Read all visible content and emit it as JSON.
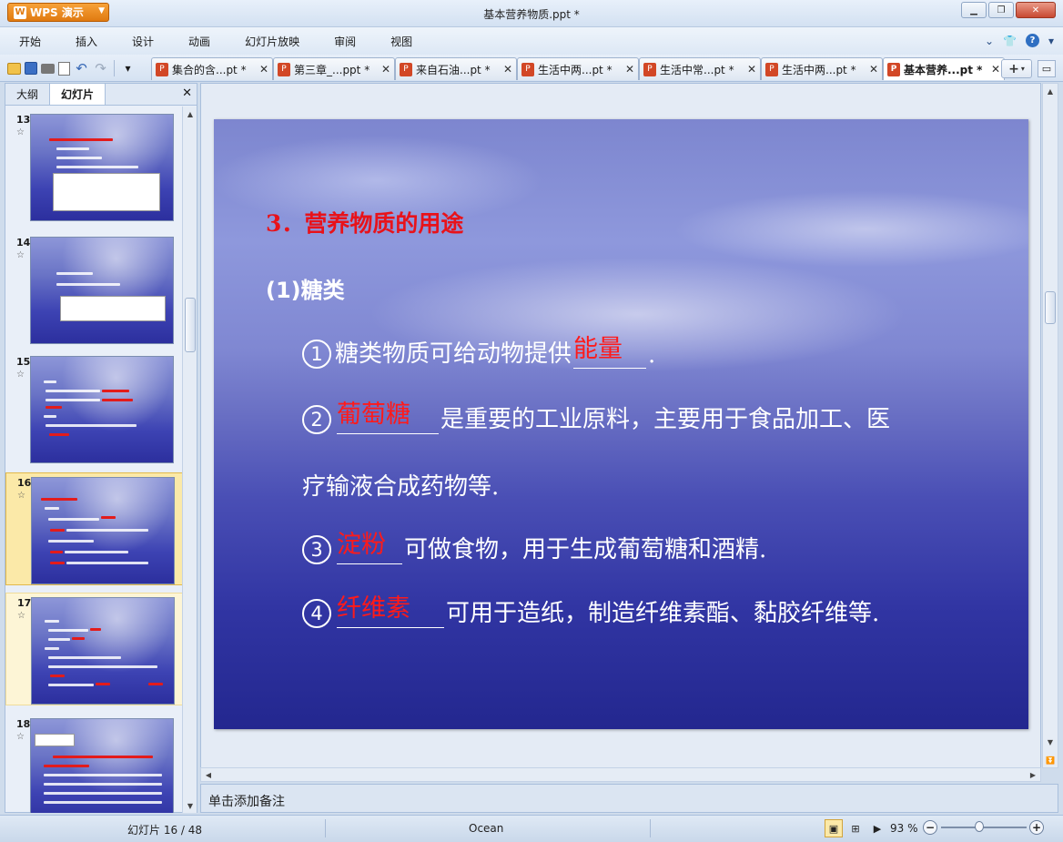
{
  "app": {
    "name": "WPS 演示",
    "window_title": "基本营养物质.ppt *"
  },
  "menu": [
    "开始",
    "插入",
    "设计",
    "动画",
    "幻灯片放映",
    "审阅",
    "视图"
  ],
  "doc_tabs": [
    {
      "label": "集合的含...pt *",
      "active": false
    },
    {
      "label": "第三章_...ppt *",
      "active": false
    },
    {
      "label": "来自石油...pt *",
      "active": false
    },
    {
      "label": "生活中两...pt *",
      "active": false
    },
    {
      "label": "生活中常...pt *",
      "active": false
    },
    {
      "label": "生活中两...pt *",
      "active": false
    },
    {
      "label": "基本营养...pt *",
      "active": true
    }
  ],
  "left_pane": {
    "tabs": [
      "大纲",
      "幻灯片"
    ],
    "active_tab": "幻灯片",
    "thumbnails": [
      {
        "num": "13",
        "star": "☆"
      },
      {
        "num": "14",
        "star": "☆"
      },
      {
        "num": "15",
        "star": "☆"
      },
      {
        "num": "16",
        "star": "☆",
        "selected": true
      },
      {
        "num": "17",
        "star": "☆"
      },
      {
        "num": "18",
        "star": "☆"
      }
    ]
  },
  "slide": {
    "title": "3．营养物质的用途",
    "subtitle": "(1)糖类",
    "lines": [
      {
        "num": "1",
        "text_before": "糖类物质可给动物提供",
        "answer": "能量",
        "text_after": "."
      },
      {
        "num": "2",
        "text_before": "",
        "answer": "葡萄糖",
        "text_after": "是重要的工业原料，主要用于食品加工、医"
      },
      {
        "num": "",
        "text_before": "疗输液合成药物等.",
        "answer": "",
        "text_after": ""
      },
      {
        "num": "3",
        "text_before": "",
        "answer": "淀粉",
        "text_after": "可做食物，用于生成葡萄糖和酒精."
      },
      {
        "num": "4",
        "text_before": "",
        "answer": "纤维素",
        "text_after": "可用于造纸，制造纤维素酯、黏胶纤维等."
      }
    ]
  },
  "notes": {
    "placeholder": "单击添加备注"
  },
  "status": {
    "slide_counter": "幻灯片 16 / 48",
    "theme": "Ocean",
    "zoom": "93 %",
    "zoom_fraction": 0.45
  },
  "colors": {
    "accent_red": "#e8121a",
    "answer_red": "#ff1a1a",
    "wps_orange": "#e07a10"
  }
}
